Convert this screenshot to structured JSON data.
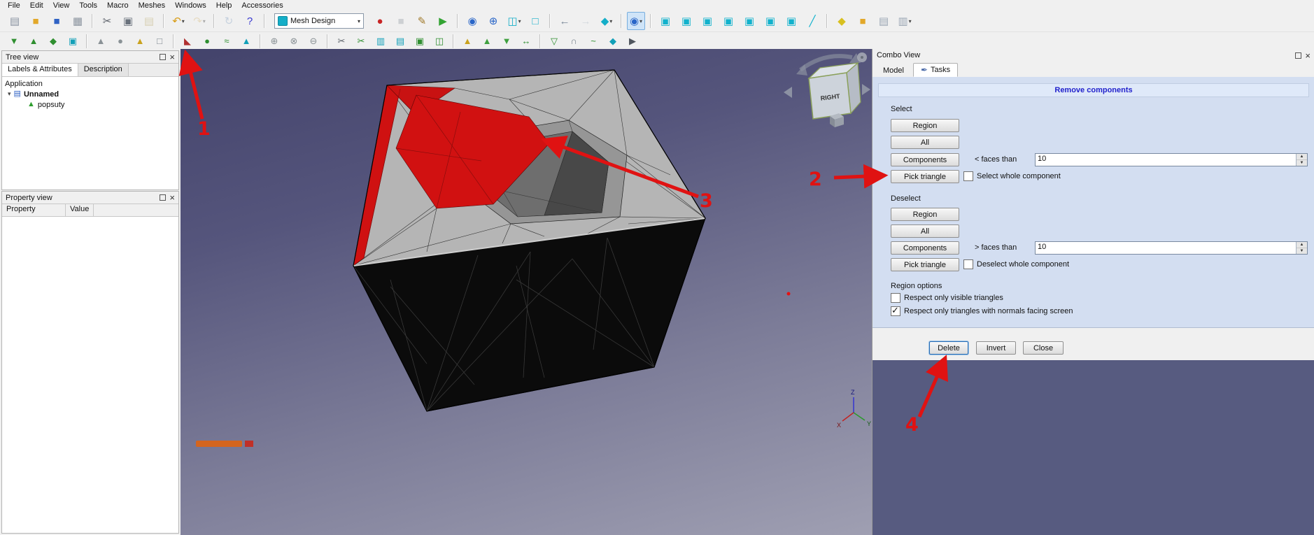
{
  "window": {
    "menu_items": [
      "File",
      "Edit",
      "View",
      "Tools",
      "Macro",
      "Meshes",
      "Windows",
      "Help",
      "Accessories"
    ]
  },
  "toolbar": {
    "workbench": {
      "label": "Mesh Design"
    },
    "row1a": [
      {
        "n": "new-file-icon",
        "g": "▤",
        "c": "#8892a0"
      },
      {
        "n": "open-file-icon",
        "g": "■",
        "c": "#e2a82a"
      },
      {
        "n": "save-icon",
        "g": "■",
        "c": "#2f62c4"
      },
      {
        "n": "print-icon",
        "g": "▦",
        "c": "#8a939e"
      },
      {
        "sep": true
      },
      {
        "n": "cut-icon",
        "g": "✂",
        "c": "#5a6068"
      },
      {
        "n": "copy-icon",
        "g": "▣",
        "c": "#6a727c"
      },
      {
        "n": "paste-icon",
        "g": "▤",
        "c": "#b4a05a",
        "d": 1
      },
      {
        "sep": true
      },
      {
        "n": "undo-icon",
        "g": "↶",
        "c": "#d89c14",
        "dd": 1
      },
      {
        "n": "redo-icon",
        "g": "↷",
        "c": "#d8bc80",
        "d": 1,
        "dd": 1
      },
      {
        "sep": true
      },
      {
        "n": "refresh-icon",
        "g": "↻",
        "c": "#8aa4c4",
        "d": 1
      },
      {
        "n": "whats-this-icon",
        "g": "?",
        "c": "#3a3ad0"
      },
      {
        "sep": true
      }
    ],
    "row1b": [
      {
        "n": "macro-record-icon",
        "g": "●",
        "c": "#c82424"
      },
      {
        "n": "macro-stop-icon",
        "g": "■",
        "c": "#9aa2aa",
        "d": 1
      },
      {
        "n": "macro-edit-icon",
        "g": "✎",
        "c": "#a07a2a"
      },
      {
        "n": "macro-play-icon",
        "g": "▶",
        "c": "#33a433"
      },
      {
        "sep": true
      },
      {
        "n": "zoom-fit-icon",
        "g": "◉",
        "c": "#2a66c8"
      },
      {
        "n": "zoom-selection-icon",
        "g": "⊕",
        "c": "#2a66c8"
      },
      {
        "n": "draw-style-icon",
        "g": "◫",
        "c": "#14aec8",
        "dd": 1
      },
      {
        "n": "select-box-icon",
        "g": "□",
        "c": "#14aec8"
      },
      {
        "sep": true
      },
      {
        "n": "nav-back-icon",
        "g": "←",
        "c": "#7a8898"
      },
      {
        "n": "nav-forward-icon",
        "g": "→",
        "c": "#aab4c0",
        "d": 1
      },
      {
        "n": "nav-style-icon",
        "g": "◆",
        "c": "#14aec8",
        "dd": 1
      },
      {
        "sep": true
      },
      {
        "n": "zoom-tool-icon",
        "g": "◉",
        "c": "#2a66c8",
        "hl": 1,
        "dd": 1
      },
      {
        "sep": true
      },
      {
        "n": "view-axonometric-icon",
        "g": "▣",
        "c": "#12b2cc"
      },
      {
        "n": "view-front-icon",
        "g": "▣",
        "c": "#12b2cc"
      },
      {
        "n": "view-top-icon",
        "g": "▣",
        "c": "#12b2cc"
      },
      {
        "n": "view-right-icon",
        "g": "▣",
        "c": "#12b2cc"
      },
      {
        "n": "view-rear-icon",
        "g": "▣",
        "c": "#12b2cc"
      },
      {
        "n": "view-bottom-icon",
        "g": "▣",
        "c": "#12b2cc"
      },
      {
        "n": "view-left-icon",
        "g": "▣",
        "c": "#12b2cc"
      },
      {
        "n": "measure-distance-icon",
        "g": "╱",
        "c": "#12b2cc"
      },
      {
        "sep": true
      },
      {
        "n": "clipping-plane-icon",
        "g": "◆",
        "c": "#d8c020"
      },
      {
        "n": "texture-mapping-icon",
        "g": "■",
        "c": "#e2a82a"
      },
      {
        "n": "export-image-icon",
        "g": "▤",
        "c": "#9aa6b4"
      },
      {
        "n": "share-view-icon",
        "g": "▥",
        "c": "#9aa6b4",
        "dd": 1
      }
    ],
    "row2": [
      {
        "n": "mesh-import-icon",
        "g": "▼",
        "c": "#2f8f30"
      },
      {
        "n": "mesh-export-icon",
        "g": "▲",
        "c": "#2f8f30"
      },
      {
        "n": "mesh-from-shape-icon",
        "g": "◆",
        "c": "#2f8f30"
      },
      {
        "n": "shape-from-mesh-icon",
        "g": "▣",
        "c": "#12a0b8"
      },
      {
        "sep": true
      },
      {
        "n": "mesh-analyze-icon",
        "g": "▲",
        "c": "#8a9296"
      },
      {
        "n": "mesh-curvature-icon",
        "g": "●",
        "c": "#8a9296"
      },
      {
        "n": "mesh-info-icon",
        "g": "▲",
        "c": "#caa21e"
      },
      {
        "n": "mesh-boundary-icon",
        "g": "□",
        "c": "#7a848e"
      },
      {
        "sep": true
      },
      {
        "n": "remove-components-icon",
        "g": "◣",
        "c": "#b03030"
      },
      {
        "n": "fill-holes-icon",
        "g": "●",
        "c": "#2f8f30"
      },
      {
        "n": "smooth-mesh-icon",
        "g": "≈",
        "c": "#2f8f30"
      },
      {
        "n": "refine-mesh-icon",
        "g": "▲",
        "c": "#12a0b8"
      },
      {
        "sep": true
      },
      {
        "n": "boolean-union-icon",
        "g": "⊕",
        "c": "#8a9296"
      },
      {
        "n": "boolean-intersection-icon",
        "g": "⊗",
        "c": "#8a9296"
      },
      {
        "n": "boolean-difference-icon",
        "g": "⊖",
        "c": "#8a9296"
      },
      {
        "sep": true
      },
      {
        "n": "trim-mesh-icon",
        "g": "✂",
        "c": "#5a6068"
      },
      {
        "n": "trim-by-plane-icon",
        "g": "✂",
        "c": "#2f8f30"
      },
      {
        "n": "section-mesh-icon",
        "g": "▥",
        "c": "#12a0b8"
      },
      {
        "n": "cross-sections-icon",
        "g": "▤",
        "c": "#12a0b8"
      },
      {
        "n": "merge-mesh-icon",
        "g": "▣",
        "c": "#2f8f30"
      },
      {
        "n": "split-mesh-icon",
        "g": "◫",
        "c": "#2f8f30"
      },
      {
        "sep": true
      },
      {
        "n": "evaluate-mesh-icon",
        "g": "▲",
        "c": "#caa21e"
      },
      {
        "n": "harmonize-normals-icon",
        "g": "▲",
        "c": "#3fa03f"
      },
      {
        "n": "flip-normals-icon",
        "g": "▼",
        "c": "#3fa03f"
      },
      {
        "n": "scale-mesh-icon",
        "g": "↔",
        "c": "#2f8f30"
      },
      {
        "sep": true
      },
      {
        "n": "decimate-icon",
        "g": "▽",
        "c": "#2f8f30"
      },
      {
        "n": "unwrap-mesh-icon",
        "g": "∩",
        "c": "#7a848e"
      },
      {
        "n": "smoothing-icon",
        "g": "~",
        "c": "#2f8f30"
      },
      {
        "n": "segmentation-icon",
        "g": "◆",
        "c": "#12a0b8"
      },
      {
        "n": "cursor-tool-icon",
        "g": "▶",
        "c": "#50565e"
      }
    ]
  },
  "tree_view": {
    "title": "Tree view",
    "tabs": [
      "Labels & Attributes",
      "Description"
    ],
    "root_label": "Application",
    "doc_label": "Unnamed",
    "child_label": "popsuty"
  },
  "property_view": {
    "title": "Property view",
    "col_property": "Property",
    "col_value": "Value"
  },
  "viewport": {
    "nav_cube_face": "RIGHT",
    "axis_x": "X",
    "axis_y": "Y",
    "axis_z": "Z"
  },
  "combo_view": {
    "title": "Combo View",
    "tab_model": "Model",
    "tab_tasks": "Tasks",
    "task_header": "Remove components",
    "select": {
      "heading": "Select",
      "region": "Region",
      "all": "All",
      "components": "Components",
      "pick": "Pick triangle",
      "faces_label": "< faces than",
      "faces_value": "10",
      "whole_label": "Select whole component",
      "whole_checked": false
    },
    "deselect": {
      "heading": "Deselect",
      "region": "Region",
      "all": "All",
      "components": "Components",
      "pick": "Pick triangle",
      "faces_label": "> faces than",
      "faces_value": "10",
      "whole_label": "Deselect whole component",
      "whole_checked": false
    },
    "region_options": {
      "heading": "Region options",
      "opt1": {
        "label": "Respect only visible triangles",
        "checked": false
      },
      "opt2": {
        "label": "Respect only triangles with normals facing screen",
        "checked": true
      }
    },
    "footer": {
      "delete": "Delete",
      "invert": "Invert",
      "close": "Close"
    }
  },
  "annotations": {
    "arrow_color": "#e01212",
    "labels": [
      "1",
      "2",
      "3",
      "4"
    ]
  }
}
